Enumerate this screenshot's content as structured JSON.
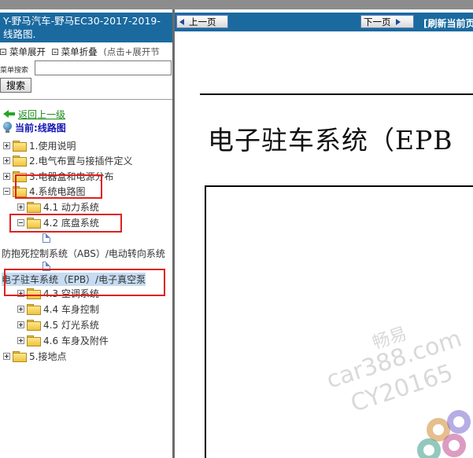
{
  "left": {
    "title": "Y-野马汽车-野马EC30-2017-2019- 线路图.",
    "menu": {
      "expand": "菜单展开",
      "collapse": "菜单折叠",
      "hint": "(点击+展开节"
    },
    "search": {
      "label": "菜单搜索",
      "value": "",
      "button": "搜索"
    },
    "back": "返回上一级",
    "current": "当前:线路图",
    "tree": {
      "t1": "1.使用说明",
      "t2": "2.电气布置与接插件定义",
      "t3": "3.电器盒和电源分布",
      "t4": "4.系统电路图",
      "t41": "4.1 动力系统",
      "t42": "4.2 底盘系统",
      "leaf1": "防抱死控制系统（ABS）/电动转向系统",
      "leaf2": "电子驻车系统（EPB）/电子真空泵",
      "t43": "4.3 空调系统",
      "t44": "4.4 车身控制",
      "t45": "4.5 灯光系统",
      "t46": "4.6 车身及附件",
      "t5": "5.接地点"
    }
  },
  "right": {
    "prev": "上一页",
    "next": "下一页",
    "refresh": "[刷新当前页]",
    "doc_title": "电子驻车系统（EPB",
    "watermark": {
      "line1": "畅易",
      "line2": "car388.com",
      "line3": "CY20165"
    }
  },
  "colors": {
    "header_blue": "#1a6aa0",
    "highlight_red": "#e02020",
    "link_green": "#1a8a1a"
  }
}
